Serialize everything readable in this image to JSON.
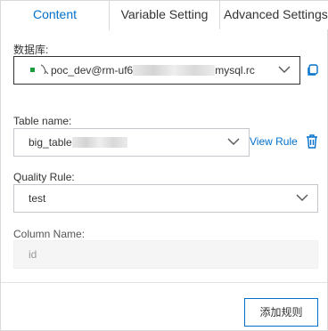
{
  "tabs": [
    {
      "label": "Content",
      "active": true
    },
    {
      "label": "Variable Setting",
      "active": false
    },
    {
      "label": "Advanced Settings",
      "active": false
    }
  ],
  "database": {
    "label": "数据库:",
    "value_prefix": "poc_dev@rm-uf6",
    "value_suffix": "mysql.rc",
    "icon": "mysql-icon",
    "status_color": "#1e9c3c"
  },
  "table_name": {
    "label": "Table name:",
    "value": "big_table"
  },
  "view_rule_label": "View Rule",
  "quality_rule": {
    "label": "Quality Rule:",
    "value": "test"
  },
  "column_name": {
    "label": "Column Name:",
    "placeholder": "id"
  },
  "add_rule_button": "添加规则",
  "colors": {
    "accent": "#0070cc",
    "border": "#d9d9d9"
  }
}
